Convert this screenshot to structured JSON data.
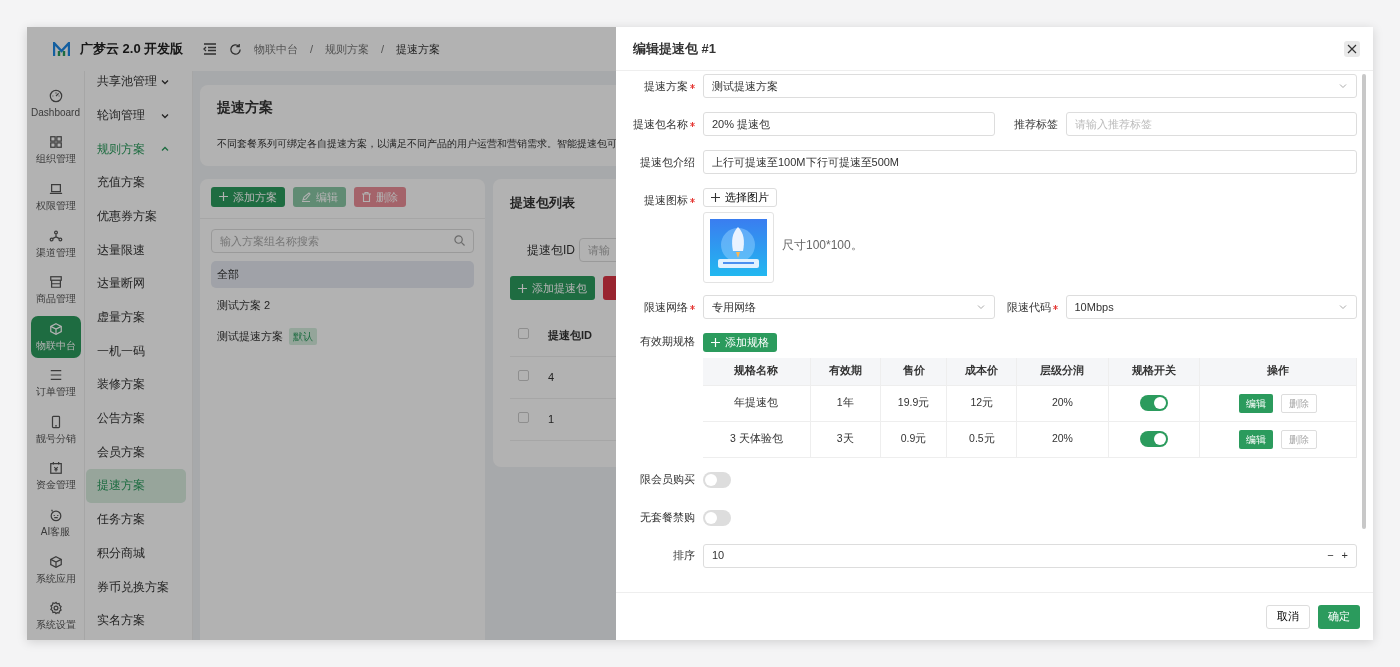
{
  "app": {
    "logo_text": "广梦云 2.0 开发版"
  },
  "rail": [
    {
      "label": "Dashboard",
      "selected": false
    },
    {
      "label": "组织管理",
      "selected": false
    },
    {
      "label": "权限管理",
      "selected": false
    },
    {
      "label": "渠道管理",
      "selected": false
    },
    {
      "label": "商品管理",
      "selected": false
    },
    {
      "label": "物联中台",
      "selected": true
    },
    {
      "label": "订单管理",
      "selected": false
    },
    {
      "label": "靓号分销",
      "selected": false
    },
    {
      "label": "资金管理",
      "selected": false
    },
    {
      "label": "AI客服",
      "selected": false
    },
    {
      "label": "系统应用",
      "selected": false
    },
    {
      "label": "系统设置",
      "selected": false
    }
  ],
  "submenu": [
    {
      "kind": "group",
      "label": "共享池管理",
      "expanded": false
    },
    {
      "kind": "group",
      "label": "轮询管理",
      "expanded": false
    },
    {
      "kind": "group",
      "label": "规则方案",
      "expanded": true
    },
    {
      "kind": "item",
      "label": "充值方案",
      "selected": false
    },
    {
      "kind": "item",
      "label": "优惠券方案",
      "selected": false
    },
    {
      "kind": "item",
      "label": "达量限速",
      "selected": false
    },
    {
      "kind": "item",
      "label": "达量断网",
      "selected": false
    },
    {
      "kind": "item",
      "label": "虚量方案",
      "selected": false
    },
    {
      "kind": "item",
      "label": "一机一码",
      "selected": false
    },
    {
      "kind": "item",
      "label": "装修方案",
      "selected": false
    },
    {
      "kind": "item",
      "label": "公告方案",
      "selected": false
    },
    {
      "kind": "item",
      "label": "会员方案",
      "selected": false
    },
    {
      "kind": "item",
      "label": "提速方案",
      "selected": true
    },
    {
      "kind": "item",
      "label": "任务方案",
      "selected": false
    },
    {
      "kind": "item",
      "label": "积分商城",
      "selected": false
    },
    {
      "kind": "item",
      "label": "券币兑换方案",
      "selected": false
    },
    {
      "kind": "item",
      "label": "实名方案",
      "selected": false
    }
  ],
  "breadcrumb": {
    "separator": "/",
    "items": [
      "物联中台",
      "规则方案",
      "提速方案"
    ]
  },
  "page": {
    "title": "提速方案",
    "description": "不同套餐系列可绑定各自提速方案，以满足不同产品的用户运营和营销需求。智能提速包可"
  },
  "scheme_panel": {
    "buttons": [
      {
        "label": "添加方案",
        "kind": "add",
        "disabled": false
      },
      {
        "label": "编辑",
        "kind": "edit",
        "disabled": true
      },
      {
        "label": "删除",
        "kind": "delete",
        "disabled": true
      }
    ],
    "search_placeholder": "输入方案组名称搜索",
    "items": [
      {
        "label": "全部",
        "selected": true
      },
      {
        "label": "测试方案 2",
        "selected": false
      },
      {
        "label": "测试提速方案",
        "badge": "默认",
        "selected": false
      }
    ]
  },
  "package_panel": {
    "title": "提速包列表",
    "filter_label": "提速包ID",
    "filter_placeholder": "请输",
    "all_checked": false,
    "add_button": "添加提速包",
    "column": "提速包ID",
    "rows": [
      {
        "id": "4",
        "checked": false
      },
      {
        "id": "1",
        "checked": false
      }
    ]
  },
  "drawer": {
    "title": "编辑提速包 #1",
    "scheme": {
      "label": "提速方案",
      "required": true,
      "value": "测试提速方案"
    },
    "name": {
      "label": "提速包名称",
      "required": true,
      "value": "20% 提速包"
    },
    "tag": {
      "label": "推荐标签",
      "required": false,
      "placeholder": "请输入推荐标签"
    },
    "intro": {
      "label": "提速包介绍",
      "required": false,
      "value": "上行可提速至100M下行可提速至500M"
    },
    "image": {
      "label": "提速图标",
      "required": true,
      "button": "选择图片",
      "hint": "尺寸100*100。"
    },
    "network": {
      "label": "限速网络",
      "required": true,
      "value": "专用网络"
    },
    "code": {
      "label": "限速代码",
      "required": true,
      "value": "10Mbps"
    },
    "specs": {
      "label": "有效期规格",
      "add_button": "添加规格",
      "columns": [
        "规格名称",
        "有效期",
        "售价",
        "成本价",
        "层级分润",
        "规格开关",
        "操作"
      ],
      "rows": [
        {
          "name": "年提速包",
          "period": "1年",
          "price": "19.9元",
          "cost": "12元",
          "share": "20%",
          "on": true,
          "edit": "编辑",
          "delete": "删除",
          "delete_disabled": true
        },
        {
          "name": "3 天体验包",
          "period": "3天",
          "price": "0.9元",
          "cost": "0.5元",
          "share": "20%",
          "on": true,
          "edit": "编辑",
          "delete": "删除",
          "delete_disabled": true
        }
      ]
    },
    "switches": [
      {
        "label": "限会员购买",
        "on": false
      },
      {
        "label": "无套餐禁购",
        "on": false
      }
    ],
    "sort": {
      "label": "排序",
      "value": "10",
      "minus": "−",
      "plus": "+"
    },
    "cancel": "取消",
    "confirm": "确定"
  }
}
